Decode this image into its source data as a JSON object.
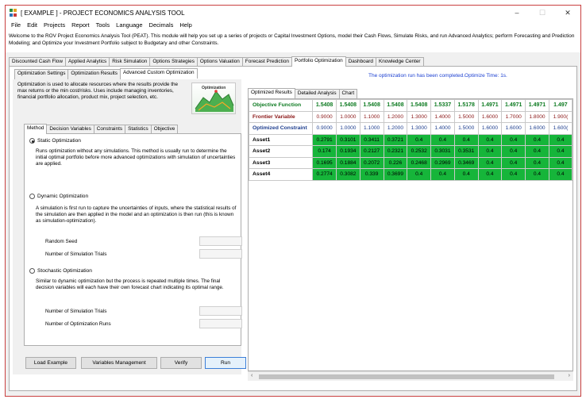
{
  "window": {
    "title": "[ EXAMPLE ] - PROJECT ECONOMICS ANALYSIS TOOL",
    "controls": [
      "–",
      "☐",
      "✕"
    ]
  },
  "menu": [
    "File",
    "Edit",
    "Projects",
    "Report",
    "Tools",
    "Language",
    "Decimals",
    "Help"
  ],
  "welcome": "Welcome to the ROV Project Economics Analysis Tool (PEAT). This module will help you set up a series of projects or Capital Investment Options, model their Cash Flows, Simulate Risks, and run Advanced Analytics; perform Forecasting and Prediction Modeling; and Optimize your Investment Portfolio subject to Budgetary and other Constraints.",
  "main_tabs": [
    "Discounted Cash Flow",
    "Applied Analytics",
    "Risk Simulation",
    "Options Strategies",
    "Options Valuation",
    "Forecast Prediction",
    "Portfolio Optimization",
    "Dashboard",
    "Knowledge Center"
  ],
  "sub_tabs": [
    "Optimization Settings",
    "Optimization Results",
    "Advanced Custom Optimization"
  ],
  "status_message": "The optimization run has been completed.Optimize Time: 1s.",
  "intro_text": "Optimization is used to allocate resources where the results provide the max returns or the min cost/risks. Uses include managing inventories, financial portfolio allocation, product mix, project selection, etc.",
  "image_label": "Optimization",
  "method_tabs": [
    "Method",
    "Decision Variables",
    "Constraints",
    "Statistics",
    "Objective"
  ],
  "methods": {
    "static": {
      "label": "Static Optimization",
      "desc": "Runs optimization without any simulations. This method is usually run to determine the initial optimal portfolio before more advanced optimizations with simulation of uncertainties are applied."
    },
    "dynamic": {
      "label": "Dynamic Optimization",
      "desc": "A simulation is first run to capture the uncertainties of inputs, where the statistical results of the simulation are then applied in the model and an optimization is then run (this is known as simulation-optimization).",
      "field1": "Random Seed",
      "field2": "Number of Simulation Trials"
    },
    "stochastic": {
      "label": "Stochastic Optimization",
      "desc": "Similar to dynamic optimization but the process is repeated multiple times. The final decision variables will each have their own forecast chart indicating its optimal range.",
      "field1": "Number of Simulation Trials",
      "field2": "Number of Optimization Runs"
    }
  },
  "buttons": {
    "load": "Load Example",
    "variables": "Variables Management",
    "verify": "Verify",
    "run": "Run"
  },
  "result_tabs": [
    "Optimized Results",
    "Detailed Analysis",
    "Chart"
  ],
  "grid": {
    "rows": [
      {
        "label": "Objective Function",
        "cls": "obj",
        "values": [
          "1.5408",
          "1.5408",
          "1.5408",
          "1.5408",
          "1.5408",
          "1.5337",
          "1.5178",
          "1.4971",
          "1.4971",
          "1.4971",
          "1.497"
        ]
      },
      {
        "label": "Frontier Variable",
        "cls": "fro",
        "values": [
          "0.9000",
          "1.0000",
          "1.1000",
          "1.2000",
          "1.3000",
          "1.4000",
          "1.5000",
          "1.6000",
          "1.7000",
          "1.8000",
          "1.900("
        ]
      },
      {
        "label": "Optimized Constraint",
        "cls": "con",
        "values": [
          "0.9000",
          "1.0000",
          "1.1000",
          "1.2000",
          "1.3000",
          "1.4000",
          "1.5000",
          "1.6000",
          "1.6000",
          "1.6000",
          "1.600("
        ]
      },
      {
        "label": "Asset1",
        "cls": "asset",
        "values": [
          "0.2791",
          "0.3101",
          "0.3411",
          "0.3721",
          "0.4",
          "0.4",
          "0.4",
          "0.4",
          "0.4",
          "0.4",
          "0.4"
        ]
      },
      {
        "label": "Asset2",
        "cls": "asset",
        "values": [
          "0.174",
          "0.1934",
          "0.2127",
          "0.2321",
          "0.2532",
          "0.3031",
          "0.3531",
          "0.4",
          "0.4",
          "0.4",
          "0.4"
        ]
      },
      {
        "label": "Asset3",
        "cls": "asset",
        "values": [
          "0.1695",
          "0.1884",
          "0.2072",
          "0.226",
          "0.2468",
          "0.2969",
          "0.3469",
          "0.4",
          "0.4",
          "0.4",
          "0.4"
        ]
      },
      {
        "label": "Asset4",
        "cls": "asset",
        "values": [
          "0.2774",
          "0.3082",
          "0.339",
          "0.3699",
          "0.4",
          "0.4",
          "0.4",
          "0.4",
          "0.4",
          "0.4",
          "0.4"
        ]
      }
    ]
  },
  "scroll": {
    "left": "‹",
    "right": "›"
  }
}
